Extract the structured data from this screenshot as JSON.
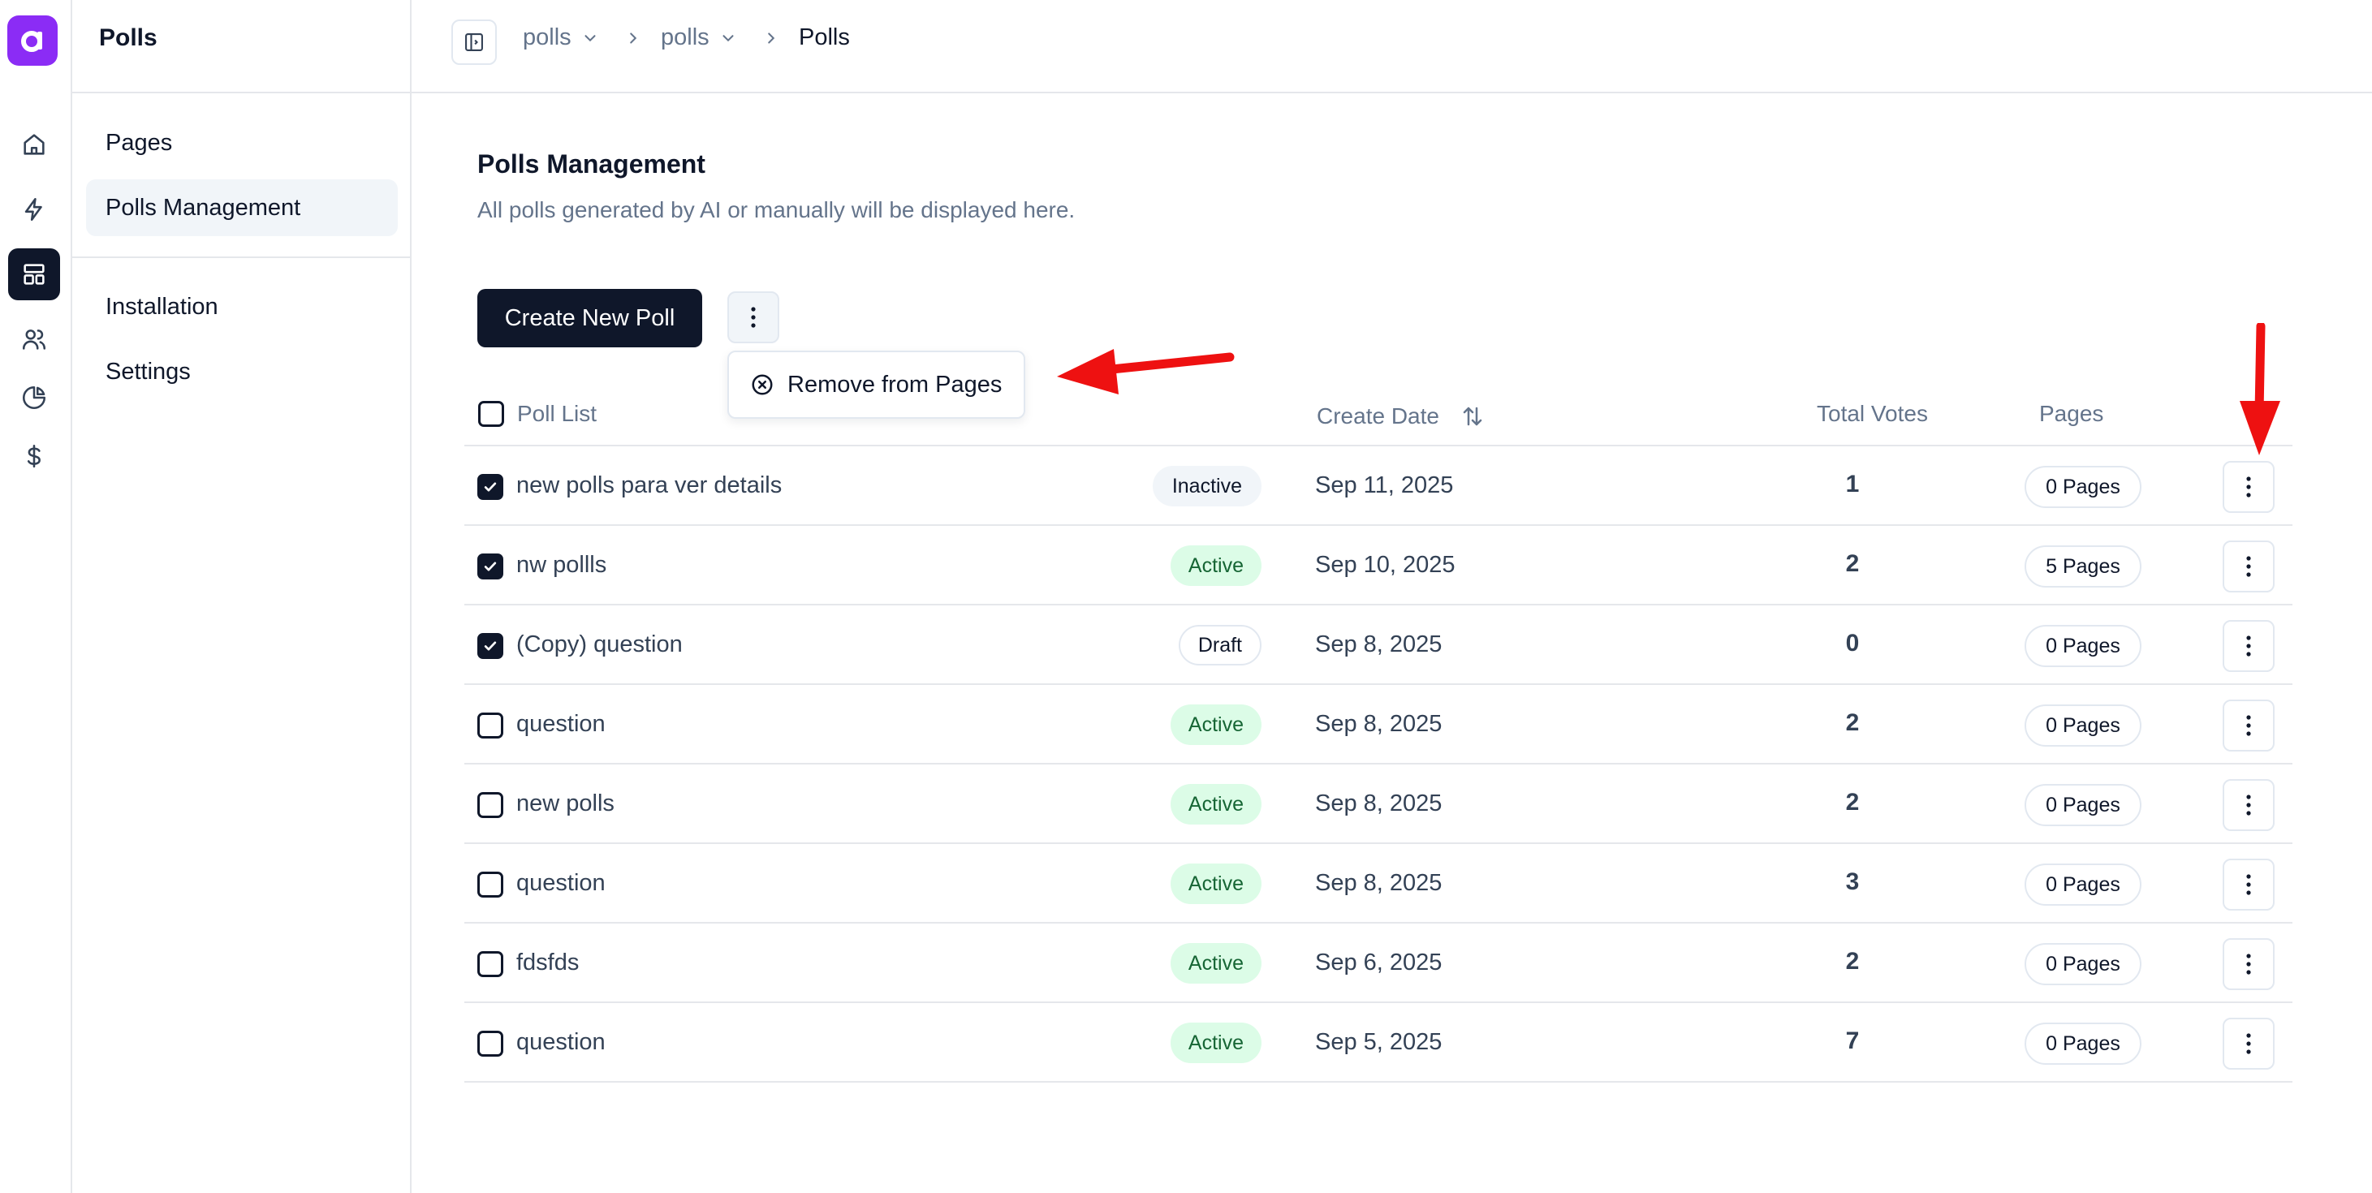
{
  "app": {
    "title": "Polls"
  },
  "sidebar": {
    "items": [
      {
        "label": "Pages"
      },
      {
        "label": "Polls Management"
      },
      {
        "label": "Installation"
      },
      {
        "label": "Settings"
      }
    ]
  },
  "breadcrumb": {
    "items": [
      {
        "label": "polls"
      },
      {
        "label": "polls"
      },
      {
        "label": "Polls"
      }
    ]
  },
  "main": {
    "title": "Polls Management",
    "subtitle": "All polls generated by AI or manually will be displayed here.",
    "create_label": "Create New Poll",
    "dropdown_item": "Remove from Pages"
  },
  "table": {
    "headers": {
      "poll_list": "Poll List",
      "create_date": "Create Date",
      "total_votes": "Total Votes",
      "pages": "Pages"
    },
    "rows": [
      {
        "name": "new polls para ver details",
        "status": "Inactive",
        "date": "Sep 11, 2025",
        "votes": "1",
        "pages": "0 Pages",
        "checked": true
      },
      {
        "name": "nw pollls",
        "status": "Active",
        "date": "Sep 10, 2025",
        "votes": "2",
        "pages": "5 Pages",
        "checked": true
      },
      {
        "name": "(Copy) question",
        "status": "Draft",
        "date": "Sep 8, 2025",
        "votes": "0",
        "pages": "0 Pages",
        "checked": true
      },
      {
        "name": "question",
        "status": "Active",
        "date": "Sep 8, 2025",
        "votes": "2",
        "pages": "0 Pages",
        "checked": false
      },
      {
        "name": "new polls",
        "status": "Active",
        "date": "Sep 8, 2025",
        "votes": "2",
        "pages": "0 Pages",
        "checked": false
      },
      {
        "name": "question",
        "status": "Active",
        "date": "Sep 8, 2025",
        "votes": "3",
        "pages": "0 Pages",
        "checked": false
      },
      {
        "name": "fdsfds",
        "status": "Active",
        "date": "Sep 6, 2025",
        "votes": "2",
        "pages": "0 Pages",
        "checked": false
      },
      {
        "name": "question",
        "status": "Active",
        "date": "Sep 5, 2025",
        "votes": "7",
        "pages": "0 Pages",
        "checked": false
      }
    ]
  },
  "colors": {
    "brand": "#8b2cf5",
    "primary": "#0f172a",
    "active_badge_bg": "#dcfce7",
    "active_badge_text": "#166534",
    "annotation_arrow": "#ee1111"
  },
  "icons": {
    "rail": [
      "home-icon",
      "lightning-icon",
      "layout-icon",
      "users-icon",
      "pie-chart-icon",
      "dollar-icon"
    ]
  }
}
